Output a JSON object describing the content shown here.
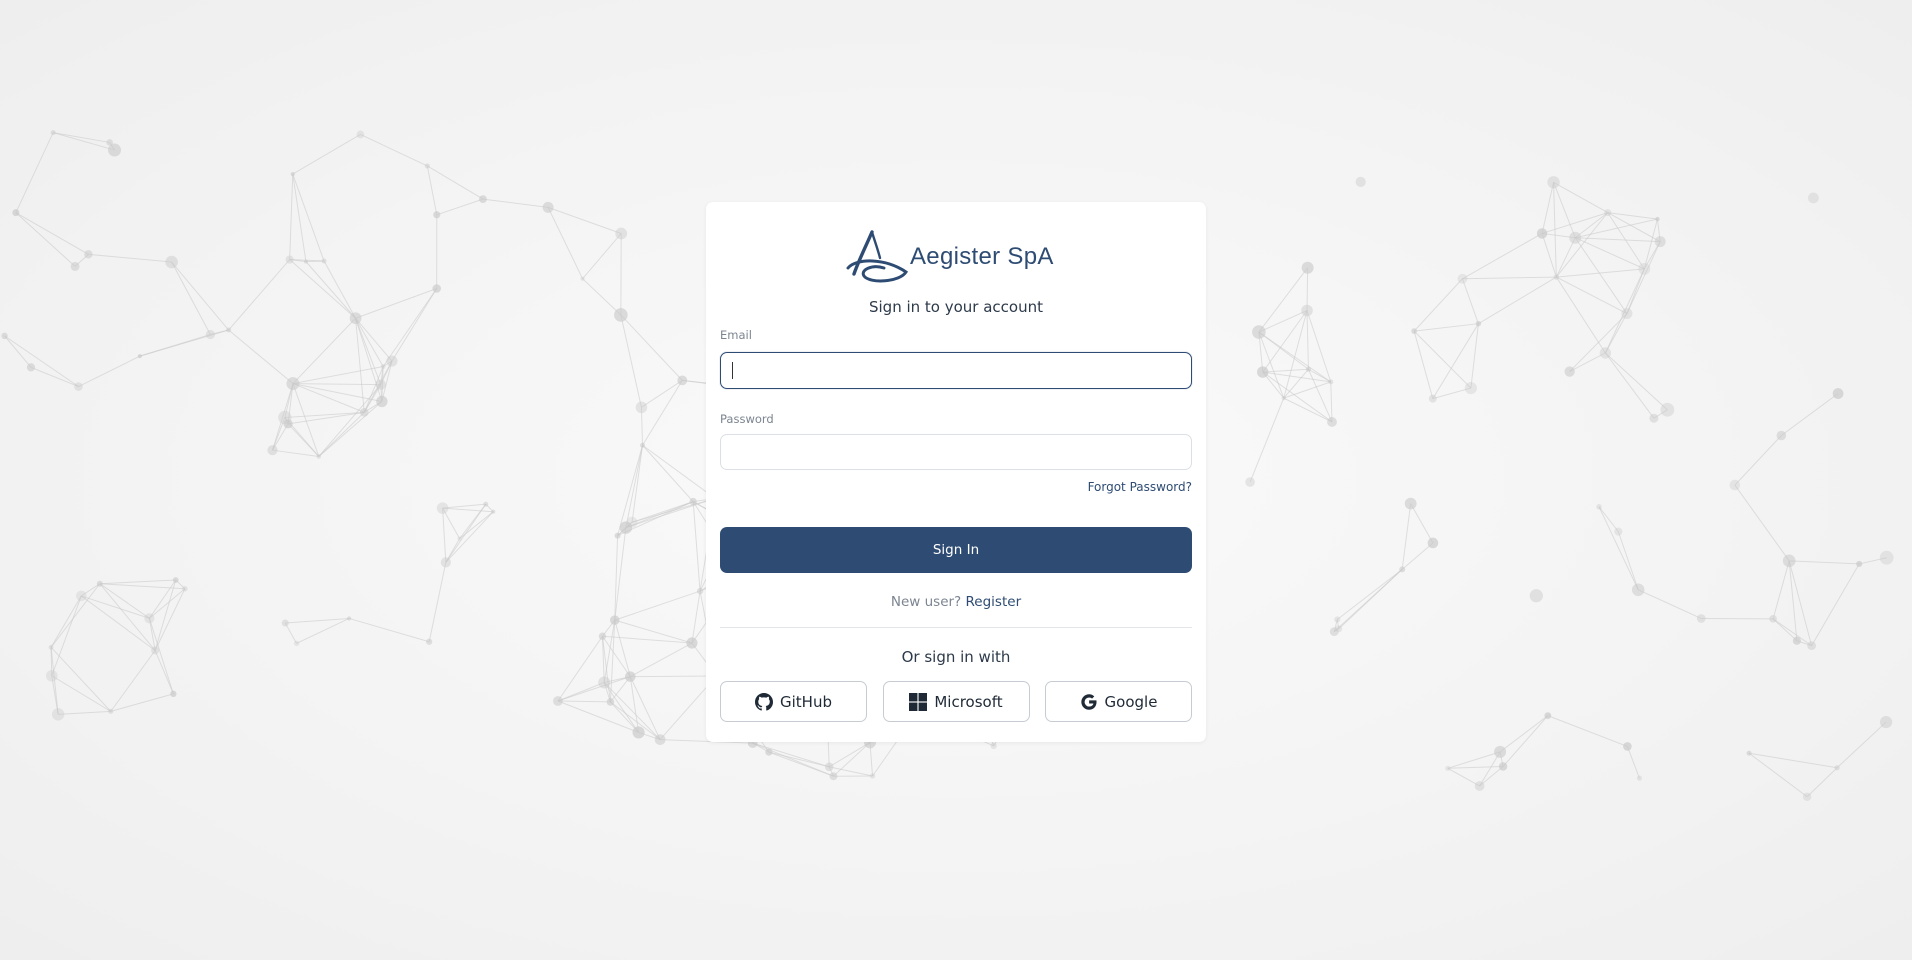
{
  "brand": {
    "name": "Aegister SpA",
    "color": "#2e4c73"
  },
  "login": {
    "heading": "Sign in to your account",
    "email_label": "Email",
    "email_value": "",
    "password_label": "Password",
    "password_value": "",
    "forgot_label": "Forgot Password?",
    "signin_label": "Sign In",
    "new_user_text": "New user?",
    "register_label": "Register",
    "or_text": "Or sign in with"
  },
  "social": [
    {
      "label": "GitHub",
      "icon": "github-icon"
    },
    {
      "label": "Microsoft",
      "icon": "microsoft-icon"
    },
    {
      "label": "Google",
      "icon": "google-icon"
    }
  ],
  "colors": {
    "primary": "#2e4c73",
    "background": "#f4f4f4",
    "network": "#c9c9c9"
  }
}
